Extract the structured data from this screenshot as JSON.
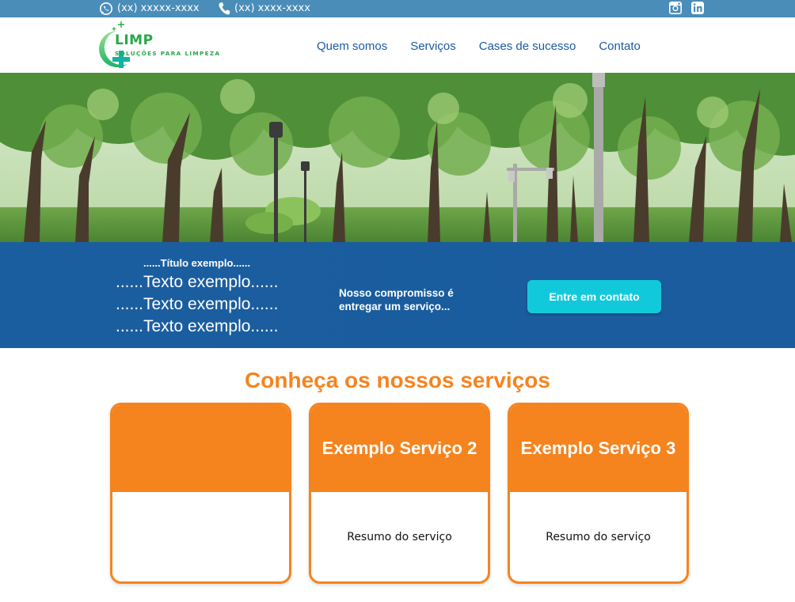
{
  "topbar": {
    "whatsapp_number": "(xx) xxxxx-xxxx",
    "whatsapp_icon": "whatsapp-icon",
    "phone_number": "(xx) xxxx-xxxx",
    "phone_icon": "phone-icon",
    "social_icons": [
      "instagram-icon",
      "linkedin-icon"
    ],
    "bg_color": "#4a8db9"
  },
  "logo": {
    "name": "LIMP",
    "tagline": "SOLUÇÕES PARA LIMPEZA",
    "color": "#27a84a"
  },
  "nav": {
    "items": [
      {
        "label": "Quem somos"
      },
      {
        "label": "Serviços"
      },
      {
        "label": "Cases de sucesso"
      },
      {
        "label": "Contato"
      }
    ],
    "color": "#1a5aa0"
  },
  "band": {
    "title": "......Título exemplo......",
    "lines": [
      "......Texto exemplo......",
      "......Texto exemplo......",
      "......Texto exemplo......"
    ],
    "commitment": "Nosso compromisso é entregar um serviço...",
    "cta_label": "Entre em contato",
    "bg_color": "#1b5e9f",
    "cta_color": "#12c9dc"
  },
  "services": {
    "title": "Conheça os nossos serviços",
    "accent": "#f5841f",
    "cards": [
      {
        "title": "",
        "summary": ""
      },
      {
        "title": "Exemplo Serviço 2",
        "summary": "Resumo do serviço"
      },
      {
        "title": "Exemplo Serviço 3",
        "summary": "Resumo do serviço"
      }
    ]
  }
}
